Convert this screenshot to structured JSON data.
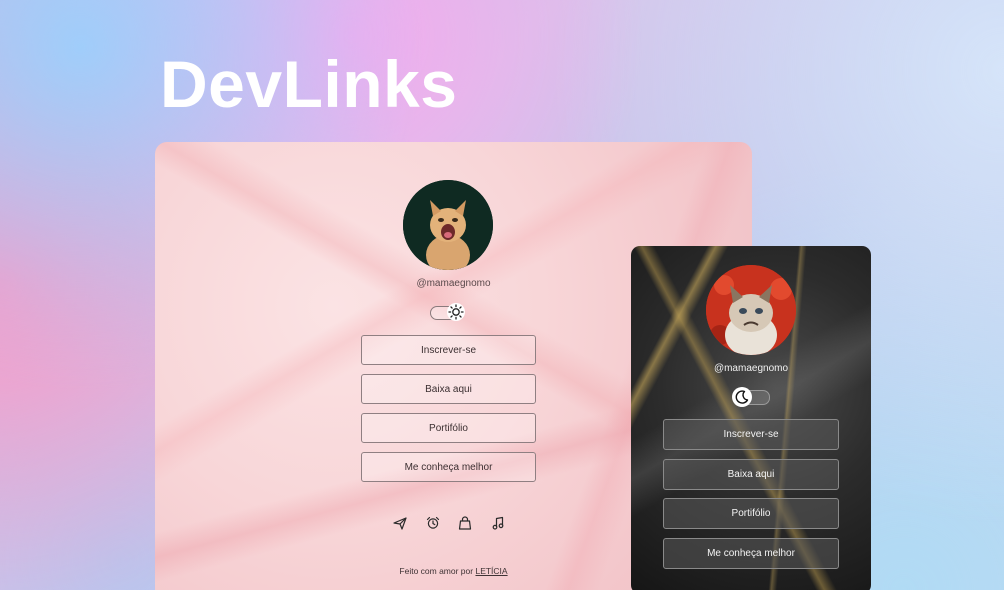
{
  "brand": {
    "title": "DevLinks"
  },
  "light_card": {
    "handle": "@mamaegnomo",
    "links": [
      "Inscrever-se",
      "Baixa aqui",
      "Portifólio",
      "Me conheça melhor"
    ],
    "social_icons": [
      "send-icon",
      "alarm-clock-icon",
      "bag-icon",
      "music-icon"
    ],
    "footer_prefix": "Feito com amor por ",
    "footer_link": "LETÍCIA",
    "toggle_icon": "sun-icon"
  },
  "dark_card": {
    "handle": "@mamaegnomo",
    "links": [
      "Inscrever-se",
      "Baixa aqui",
      "Portifólio",
      "Me conheça melhor"
    ],
    "toggle_icon": "moon-icon"
  },
  "colors": {
    "title": "#ffffff",
    "light_card_bg": "#f8d6d8",
    "dark_card_bg": "#2c2c2c",
    "dark_accent_gold": "#d6b45f"
  }
}
